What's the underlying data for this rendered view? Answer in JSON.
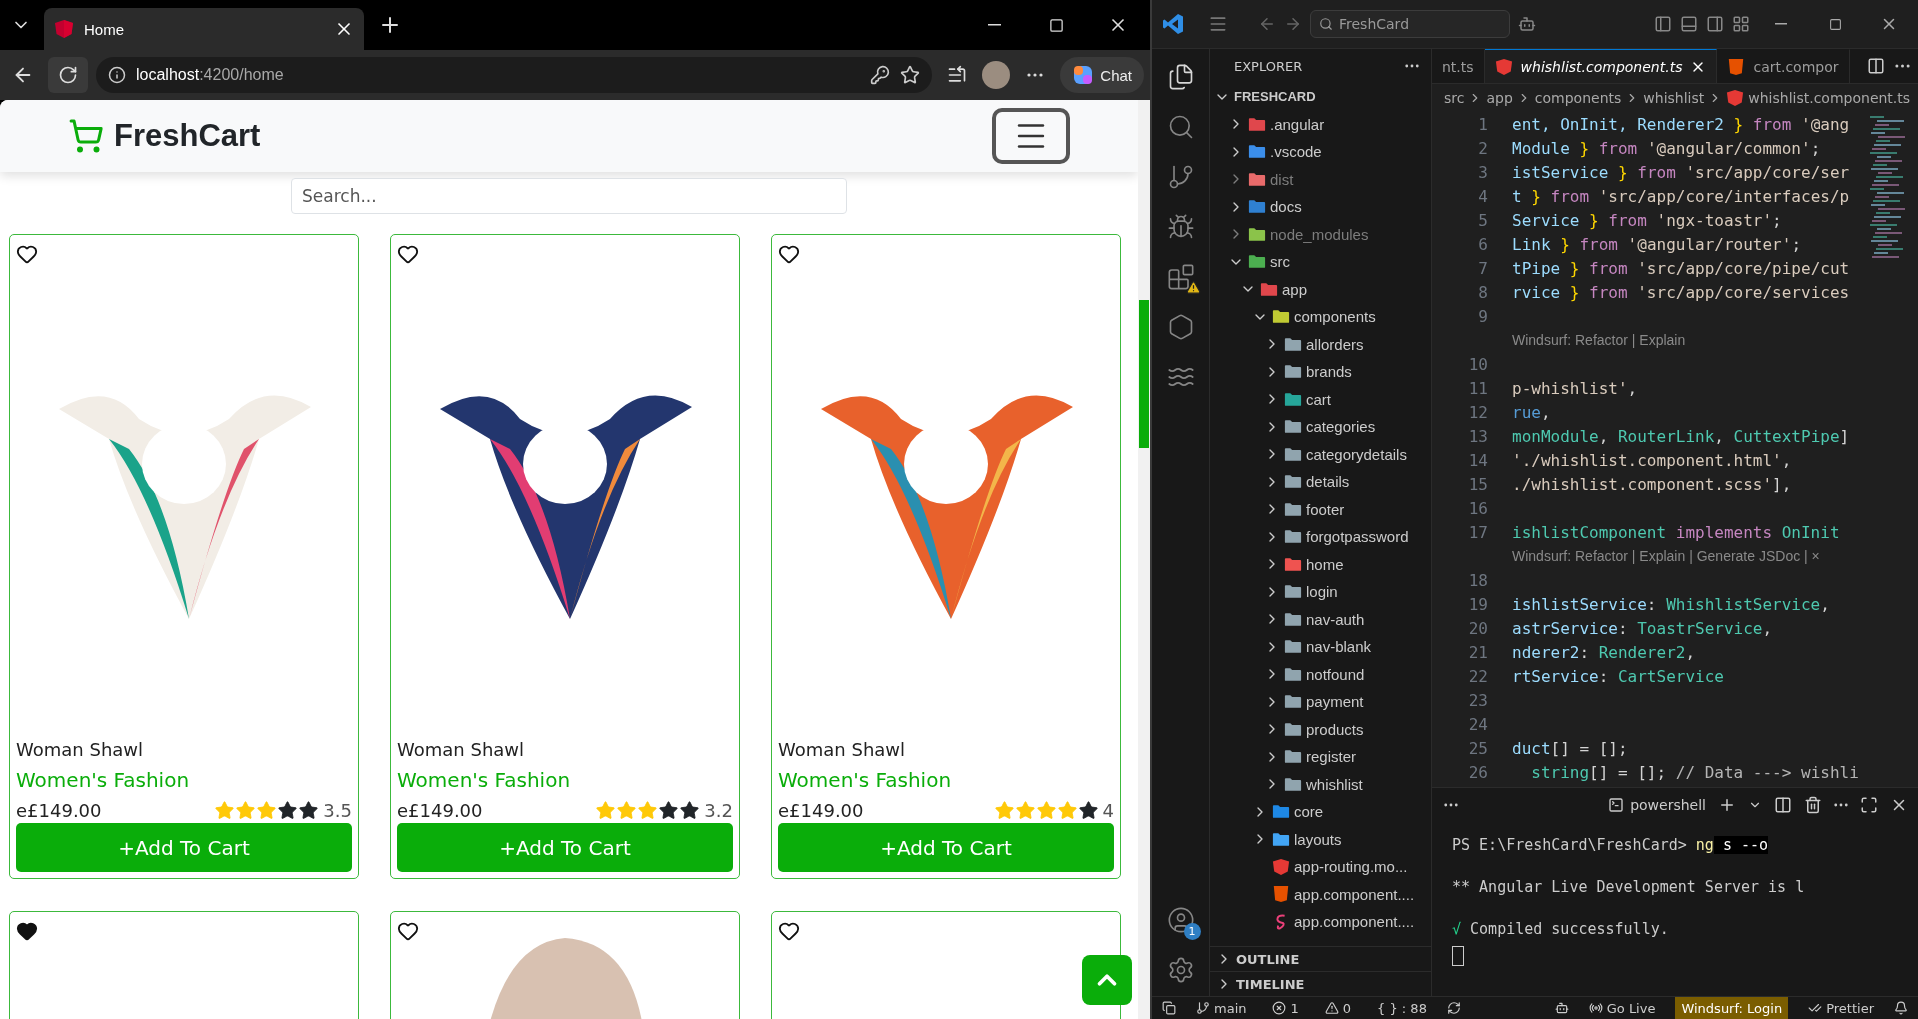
{
  "browser": {
    "tabs": [
      {
        "title": "Home",
        "selected": true
      }
    ],
    "address": {
      "host": "localhost",
      "path": ":4200/home"
    },
    "chat_button": "Chat",
    "page": {
      "brand": "FreshCart",
      "search": {
        "placeholder": "Search..."
      },
      "products": [
        {
          "name": "Woman Shawl",
          "category": "Women's Fashion",
          "price": "e£149.00",
          "stars": 3,
          "rating": "3.5",
          "favorite": false,
          "button": "+Add To Cart"
        },
        {
          "name": "Woman Shawl",
          "category": "Women's Fashion",
          "price": "e£149.00",
          "stars": 3,
          "rating": "3.2",
          "favorite": false,
          "button": "+Add To Cart"
        },
        {
          "name": "Woman Shawl",
          "category": "Women's Fashion",
          "price": "e£149.00",
          "stars": 4,
          "rating": "4",
          "favorite": false,
          "button": "+Add To Cart"
        }
      ],
      "more_products": [
        {
          "favorite": true,
          "photo": false
        },
        {
          "favorite": false,
          "photo": true
        },
        {
          "favorite": false,
          "photo": false
        }
      ]
    }
  },
  "editor": {
    "title_search": "FreshCard",
    "explorer": {
      "title": "EXPLORER",
      "root": {
        "label": "FRESHCARD",
        "expanded": true,
        "children": [
          {
            "label": ".angular",
            "kind": "folder",
            "color": "#e0474c",
            "expanded": false,
            "dimmed": false
          },
          {
            "label": ".vscode",
            "kind": "folder",
            "color": "#3b8eea",
            "expanded": false,
            "dimmed": false
          },
          {
            "label": "dist",
            "kind": "folder",
            "color": "#e86a6a",
            "expanded": false,
            "dimmed": true
          },
          {
            "label": "docs",
            "kind": "folder",
            "color": "#2f80d1",
            "expanded": false,
            "dimmed": false
          },
          {
            "label": "node_modules",
            "kind": "folder",
            "color": "#8bc34a",
            "expanded": false,
            "dimmed": true
          },
          {
            "label": "src",
            "kind": "folder",
            "color": "#4caf50",
            "expanded": true,
            "dimmed": false,
            "children": [
              {
                "label": "app",
                "kind": "folder",
                "color": "#e0474c",
                "expanded": true,
                "children": [
                  {
                    "label": "components",
                    "kind": "folder",
                    "color": "#c0ca33",
                    "expanded": true,
                    "children": [
                      {
                        "label": "allorders",
                        "kind": "folder",
                        "color": "#90a4ae",
                        "expanded": false
                      },
                      {
                        "label": "brands",
                        "kind": "folder",
                        "color": "#90a4ae",
                        "expanded": false
                      },
                      {
                        "label": "cart",
                        "kind": "folder",
                        "color": "#26a69a",
                        "expanded": false
                      },
                      {
                        "label": "categories",
                        "kind": "folder",
                        "color": "#90a4ae",
                        "expanded": false
                      },
                      {
                        "label": "categorydetails",
                        "kind": "folder",
                        "color": "#90a4ae",
                        "expanded": false
                      },
                      {
                        "label": "details",
                        "kind": "folder",
                        "color": "#90a4ae",
                        "expanded": false
                      },
                      {
                        "label": "footer",
                        "kind": "folder",
                        "color": "#90a4ae",
                        "expanded": false
                      },
                      {
                        "label": "forgotpassword",
                        "kind": "folder",
                        "color": "#90a4ae",
                        "expanded": false
                      },
                      {
                        "label": "home",
                        "kind": "folder",
                        "color": "#ef5350",
                        "expanded": false
                      },
                      {
                        "label": "login",
                        "kind": "folder",
                        "color": "#90a4ae",
                        "expanded": false
                      },
                      {
                        "label": "nav-auth",
                        "kind": "folder",
                        "color": "#90a4ae",
                        "expanded": false
                      },
                      {
                        "label": "nav-blank",
                        "kind": "folder",
                        "color": "#90a4ae",
                        "expanded": false
                      },
                      {
                        "label": "notfound",
                        "kind": "folder",
                        "color": "#90a4ae",
                        "expanded": false
                      },
                      {
                        "label": "payment",
                        "kind": "folder",
                        "color": "#90a4ae",
                        "expanded": false
                      },
                      {
                        "label": "products",
                        "kind": "folder",
                        "color": "#90a4ae",
                        "expanded": false
                      },
                      {
                        "label": "register",
                        "kind": "folder",
                        "color": "#90a4ae",
                        "expanded": false
                      },
                      {
                        "label": "whishlist",
                        "kind": "folder",
                        "color": "#90a4ae",
                        "expanded": false
                      }
                    ]
                  },
                  {
                    "label": "core",
                    "kind": "folder",
                    "color": "#1e88e5",
                    "expanded": false
                  },
                  {
                    "label": "layouts",
                    "kind": "folder",
                    "color": "#42a5f5",
                    "expanded": false
                  },
                  {
                    "label": "app-routing.mo...",
                    "kind": "angular"
                  },
                  {
                    "label": "app.component....",
                    "kind": "html"
                  },
                  {
                    "label": "app.component....",
                    "kind": "sass"
                  }
                ]
              }
            ]
          }
        ]
      },
      "sections": [
        {
          "label": "OUTLINE",
          "expanded": false
        },
        {
          "label": "TIMELINE",
          "expanded": false
        }
      ]
    },
    "tabs": [
      {
        "label": "nt.ts",
        "kind": "plain",
        "selected": false
      },
      {
        "label": "whishlist.component.ts",
        "kind": "angular",
        "selected": true
      },
      {
        "label": "cart.compor",
        "kind": "html",
        "selected": false
      }
    ],
    "breadcrumbs": [
      "src",
      "app",
      "components",
      "whishlist",
      "whishlist.component.ts"
    ],
    "code": [
      {
        "kind": "code",
        "number": "1",
        "segments": [
          {
            "text": "ent, OnInit, Renderer2 ",
            "kind": "var"
          },
          {
            "text": "}",
            "kind": "brace"
          },
          {
            "text": " from ",
            "kind": "keyword"
          },
          {
            "text": "'@ang",
            "kind": "string"
          }
        ]
      },
      {
        "kind": "code",
        "number": "2",
        "segments": [
          {
            "text": "Module ",
            "kind": "var"
          },
          {
            "text": "}",
            "kind": "brace"
          },
          {
            "text": " from ",
            "kind": "keyword"
          },
          {
            "text": "'@angular/common'",
            "kind": "string"
          },
          {
            "text": ";",
            "kind": "punct"
          }
        ]
      },
      {
        "kind": "code",
        "number": "3",
        "segments": [
          {
            "text": "istService ",
            "kind": "var"
          },
          {
            "text": "}",
            "kind": "brace"
          },
          {
            "text": " from ",
            "kind": "keyword"
          },
          {
            "text": "'src/app/core/ser",
            "kind": "string"
          }
        ]
      },
      {
        "kind": "code",
        "number": "4",
        "segments": [
          {
            "text": "t ",
            "kind": "var"
          },
          {
            "text": "}",
            "kind": "brace"
          },
          {
            "text": " from ",
            "kind": "keyword"
          },
          {
            "text": "'src/app/core/interfaces/p",
            "kind": "string"
          }
        ]
      },
      {
        "kind": "code",
        "number": "5",
        "segments": [
          {
            "text": "Service ",
            "kind": "var"
          },
          {
            "text": "}",
            "kind": "brace"
          },
          {
            "text": " from ",
            "kind": "keyword"
          },
          {
            "text": "'ngx-toastr'",
            "kind": "string"
          },
          {
            "text": ";",
            "kind": "punct"
          }
        ]
      },
      {
        "kind": "code",
        "number": "6",
        "segments": [
          {
            "text": "Link ",
            "kind": "var"
          },
          {
            "text": "}",
            "kind": "brace"
          },
          {
            "text": " from ",
            "kind": "keyword"
          },
          {
            "text": "'@angular/router'",
            "kind": "string"
          },
          {
            "text": ";",
            "kind": "punct"
          }
        ]
      },
      {
        "kind": "code",
        "number": "7",
        "segments": [
          {
            "text": "tPipe ",
            "kind": "var"
          },
          {
            "text": "}",
            "kind": "brace"
          },
          {
            "text": " from ",
            "kind": "keyword"
          },
          {
            "text": "'src/app/core/pipe/cut",
            "kind": "string"
          }
        ]
      },
      {
        "kind": "code",
        "number": "8",
        "segments": [
          {
            "text": "rvice ",
            "kind": "var"
          },
          {
            "text": "}",
            "kind": "brace"
          },
          {
            "text": " from ",
            "kind": "keyword"
          },
          {
            "text": "'src/app/core/services",
            "kind": "string"
          }
        ]
      },
      {
        "kind": "code",
        "number": "9"
      },
      {
        "kind": "lens",
        "text": "Windsurf: Refactor | Explain"
      },
      {
        "kind": "code",
        "number": "10"
      },
      {
        "kind": "code",
        "number": "11",
        "segments": [
          {
            "text": "p-whishlist'",
            "kind": "string"
          },
          {
            "text": ",",
            "kind": "punct"
          }
        ]
      },
      {
        "kind": "code",
        "number": "12",
        "segments": [
          {
            "text": "rue",
            "kind": "bool"
          },
          {
            "text": ",",
            "kind": "punct"
          }
        ]
      },
      {
        "kind": "code",
        "number": "13",
        "segments": [
          {
            "text": "monModule",
            "kind": "type"
          },
          {
            "text": ", ",
            "kind": "punct"
          },
          {
            "text": "RouterLink",
            "kind": "type"
          },
          {
            "text": ", ",
            "kind": "punct"
          },
          {
            "text": "CuttextPipe",
            "kind": "type"
          },
          {
            "text": "]",
            "kind": "punct"
          }
        ]
      },
      {
        "kind": "code",
        "number": "14",
        "segments": [
          {
            "text": "'./whishlist.component.html'",
            "kind": "string"
          },
          {
            "text": ",",
            "kind": "punct"
          }
        ]
      },
      {
        "kind": "code",
        "number": "15",
        "segments": [
          {
            "text": "./whishlist.component.scss'",
            "kind": "string"
          },
          {
            "text": "],",
            "kind": "punct"
          }
        ]
      },
      {
        "kind": "code",
        "number": "16"
      },
      {
        "kind": "code",
        "number": "17",
        "segments": [
          {
            "text": "ishlistComponent",
            "kind": "type"
          },
          {
            "text": " implements ",
            "kind": "keyword"
          },
          {
            "text": "OnInit",
            "kind": "type"
          }
        ]
      },
      {
        "kind": "lens",
        "text": "Windsurf: Refactor | Explain | Generate JSDoc | ×"
      },
      {
        "kind": "code",
        "number": "18"
      },
      {
        "kind": "code",
        "number": "19",
        "segments": [
          {
            "text": "ishlistService",
            "kind": "var"
          },
          {
            "text": ": ",
            "kind": "punct"
          },
          {
            "text": "WhishlistService",
            "kind": "type"
          },
          {
            "text": ",",
            "kind": "punct"
          }
        ]
      },
      {
        "kind": "code",
        "number": "20",
        "segments": [
          {
            "text": "astrService",
            "kind": "var"
          },
          {
            "text": ": ",
            "kind": "punct"
          },
          {
            "text": "ToastrService",
            "kind": "type"
          },
          {
            "text": ",",
            "kind": "punct"
          }
        ]
      },
      {
        "kind": "code",
        "number": "21",
        "segments": [
          {
            "text": "nderer2",
            "kind": "var"
          },
          {
            "text": ": ",
            "kind": "punct"
          },
          {
            "text": "Renderer2",
            "kind": "type"
          },
          {
            "text": ",",
            "kind": "punct"
          }
        ]
      },
      {
        "kind": "code",
        "number": "22",
        "segments": [
          {
            "text": "rtService",
            "kind": "var"
          },
          {
            "text": ": ",
            "kind": "punct"
          },
          {
            "text": "CartService",
            "kind": "type"
          }
        ]
      },
      {
        "kind": "code",
        "number": "23"
      },
      {
        "kind": "code",
        "number": "24"
      },
      {
        "kind": "code",
        "number": "25",
        "segments": [
          {
            "text": "duct",
            "kind": "var"
          },
          {
            "text": "[] = [];",
            "kind": "punct"
          }
        ]
      },
      {
        "kind": "code",
        "number": "26",
        "segments": [
          {
            "text": "  string",
            "kind": "type"
          },
          {
            "text": "[] = []; ",
            "kind": "punct"
          },
          {
            "text": "// Data ---> wishli",
            "kind": "comment"
          }
        ]
      }
    ],
    "terminal": {
      "shell": "powershell",
      "lines": [
        {
          "segments": [
            {
              "text": "PS E:\\FreshCard\\FreshCard> ",
              "kind": "plain"
            },
            {
              "text": "ng",
              "kind": "command"
            },
            {
              "text": " s --o",
              "kind": "selected"
            }
          ]
        },
        {
          "segments": [
            {
              "text": "** Angular Live Development Server is l",
              "kind": "plain"
            }
          ]
        },
        {
          "segments": [
            {
              "text": "√",
              "kind": "success"
            },
            {
              "text": " Compiled successfully.",
              "kind": "plain"
            }
          ]
        }
      ]
    },
    "accounts_badge": "1",
    "status_bar": {
      "left": [
        {
          "kind": "branch",
          "text": "main"
        },
        {
          "kind": "errors",
          "text": "1"
        },
        {
          "kind": "warnings",
          "text": "0"
        },
        {
          "kind": "plain",
          "text": "{ } : 88"
        }
      ],
      "right": [
        {
          "kind": "live",
          "text": "Go Live",
          "highlighted": false
        },
        {
          "kind": "plain",
          "text": "Windsurf: Login",
          "highlighted": true
        },
        {
          "kind": "prettier",
          "text": "Prettier",
          "highlighted": false
        }
      ]
    }
  }
}
